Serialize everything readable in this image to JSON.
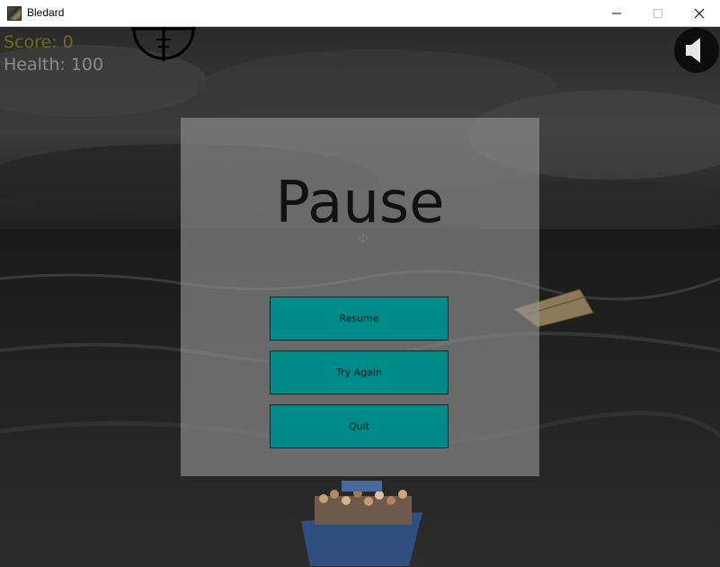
{
  "window": {
    "title": "Bledard"
  },
  "hud": {
    "score": "Score: 0",
    "health": "Health: 100"
  },
  "pause": {
    "title": "Pause",
    "buttons": {
      "resume": "Resume",
      "try_again": "Try Again",
      "quit": "Quit"
    }
  },
  "colors": {
    "button": "#008b8b",
    "score": "#6e6a1a",
    "health": "#8c8c8c"
  },
  "icons": {
    "sound": "speaker-icon",
    "crosshair": "crosshair-icon"
  }
}
